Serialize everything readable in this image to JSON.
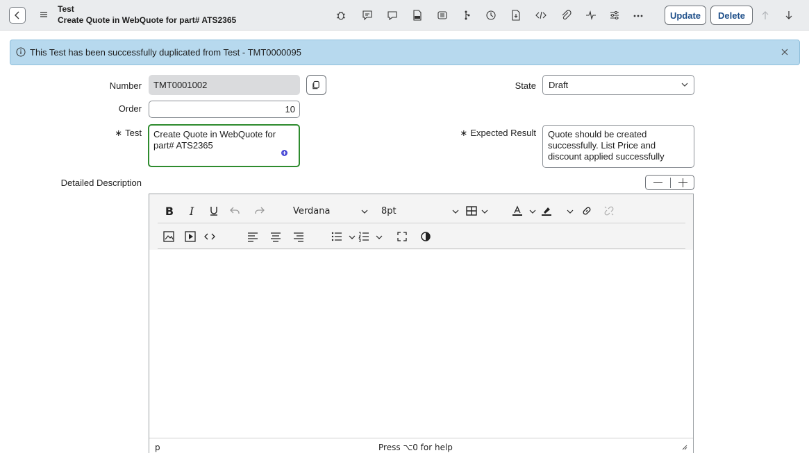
{
  "header": {
    "title": "Test",
    "subtitle": "Create Quote in WebQuote for part# ATS2365",
    "tools": [
      "bug-icon",
      "comment-icon",
      "chat-icon",
      "image-file-icon",
      "list-icon",
      "flow-icon",
      "clock-icon",
      "export-icon",
      "code-icon",
      "attachment-icon",
      "activity-icon",
      "settings-sliders-icon",
      "more-icon"
    ],
    "update_label": "Update",
    "delete_label": "Delete"
  },
  "banner": {
    "message": "This Test has been successfully duplicated from Test - TMT0000095"
  },
  "form": {
    "number_label": "Number",
    "number_value": "TMT0001002",
    "order_label": "Order",
    "order_value": "10",
    "test_label": "Test",
    "test_value": "Create Quote in WebQuote for part# ATS2365",
    "state_label": "State",
    "state_value": "Draft",
    "expected_label": "Expected Result",
    "expected_value": "Quote should be created successfully. List Price and discount applied successfully",
    "detailed_label": "Detailed Description",
    "required_mark": "∗"
  },
  "editor": {
    "font_family": "Verdana",
    "font_size": "8pt",
    "status_path": "p",
    "status_help": "Press ⌥0 for help"
  },
  "colors": {
    "banner_bg": "#b7d9ee",
    "button_text": "#1d4e89",
    "focus_border": "#2e8b2e"
  }
}
